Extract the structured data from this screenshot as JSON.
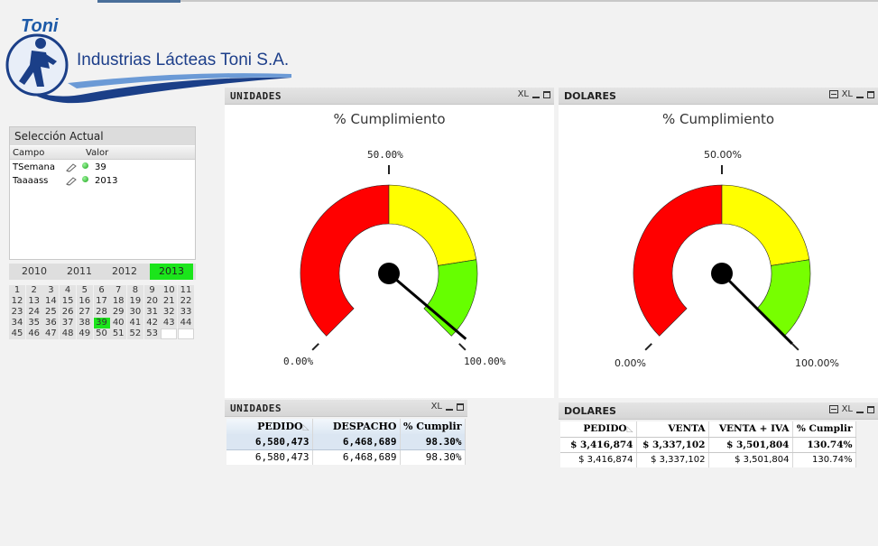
{
  "company": {
    "brand": "Toni",
    "name": "Industrias Lácteas Toni S.A."
  },
  "selection": {
    "title": "Selección Actual",
    "headers": {
      "field": "Campo",
      "value": "Valor"
    },
    "rows": [
      {
        "field": "TSemana",
        "value": "39"
      },
      {
        "field": "Taaaass",
        "value": "2013"
      }
    ]
  },
  "years": [
    "2010",
    "2011",
    "2012",
    "2013"
  ],
  "selected_year": "2013",
  "weeks": [
    "1",
    "2",
    "3",
    "4",
    "5",
    "6",
    "7",
    "8",
    "9",
    "10",
    "11",
    "12",
    "13",
    "14",
    "15",
    "16",
    "17",
    "18",
    "19",
    "20",
    "21",
    "22",
    "23",
    "24",
    "25",
    "26",
    "27",
    "28",
    "29",
    "30",
    "31",
    "32",
    "33",
    "34",
    "35",
    "36",
    "37",
    "38",
    "39",
    "40",
    "41",
    "42",
    "43",
    "44",
    "45",
    "46",
    "47",
    "48",
    "49",
    "50",
    "51",
    "52",
    "53"
  ],
  "selected_week": "39",
  "gauges": {
    "unidades": {
      "caption": "UNIDADES",
      "icons": {
        "xl": "XL"
      },
      "title": "% Cumplimiento",
      "label_min": "0.00%",
      "label_mid": "50.00%",
      "label_max": "100.00%",
      "value": 0.983,
      "colors": {
        "red": "#ff0000",
        "yellow": "#ffff00",
        "green": "#66ff00"
      }
    },
    "dolares": {
      "caption": "DOLARES",
      "icons": {
        "xl": "XL"
      },
      "title": "% Cumplimiento",
      "label_min": "0.00%",
      "label_mid": "50.00%",
      "label_max": "100.00%",
      "value": 1.3074,
      "colors": {
        "red": "#ff0000",
        "yellow": "#ffff00",
        "green": "#77ff00"
      }
    }
  },
  "tables": {
    "unidades": {
      "caption": "UNIDADES",
      "headers": [
        "PEDIDO",
        "DESPACHO",
        "% Cumplir"
      ],
      "total": [
        "6,580,473",
        "6,468,689",
        "98.30%"
      ],
      "rows": [
        [
          "6,580,473",
          "6,468,689",
          "98.30%"
        ]
      ]
    },
    "dolares": {
      "caption": "DOLARES",
      "headers": [
        "PEDIDO",
        "VENTA",
        "VENTA + IVA",
        "% Cumplir"
      ],
      "total": [
        "$ 3,416,874",
        "$ 3,337,102",
        "$ 3,501,804",
        "130.74%"
      ],
      "rows": [
        [
          "$ 3,416,874",
          "$ 3,337,102",
          "$ 3,501,804",
          "130.74%"
        ]
      ]
    }
  }
}
